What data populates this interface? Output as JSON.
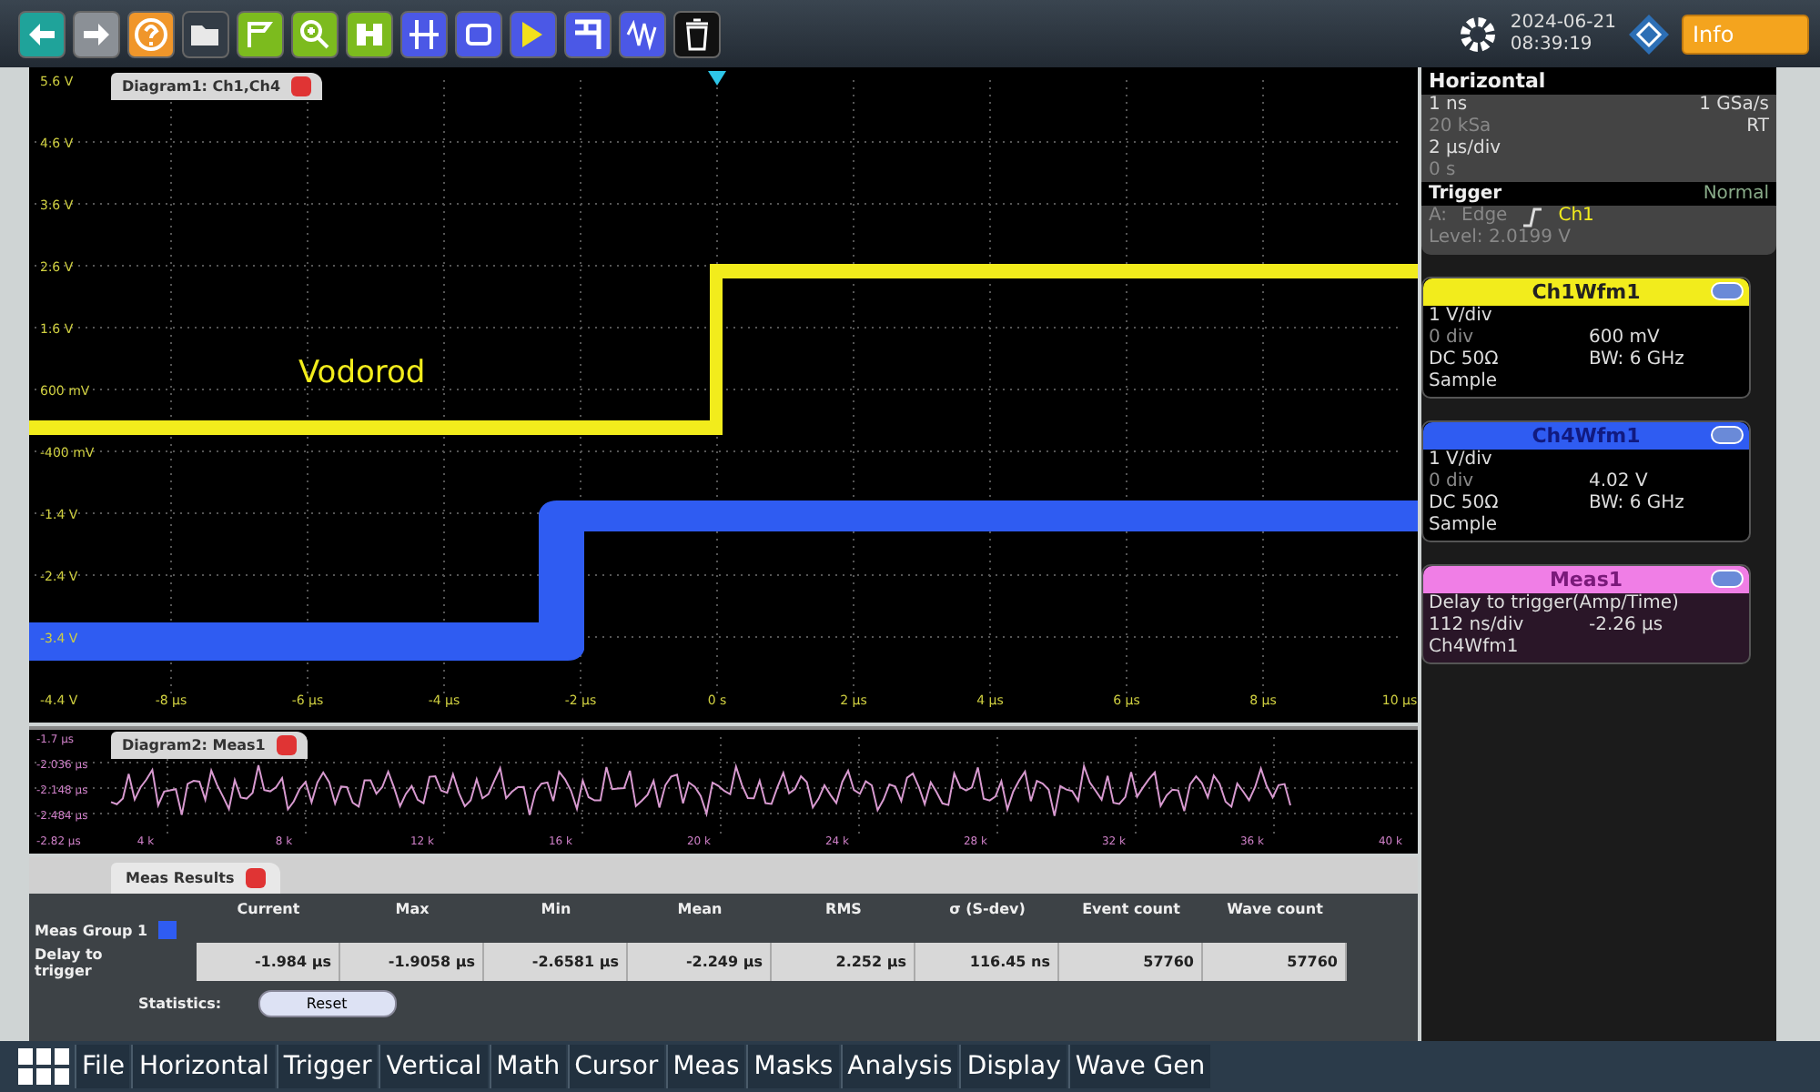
{
  "toolbar": {
    "tools": [
      {
        "kind": "back"
      },
      {
        "kind": "forward"
      },
      {
        "kind": "help"
      },
      {
        "kind": "open"
      },
      {
        "kind": "save"
      },
      {
        "kind": "zoom"
      },
      {
        "kind": "find"
      },
      {
        "kind": "cursor"
      },
      {
        "kind": "rect"
      },
      {
        "kind": "flag"
      },
      {
        "kind": "marker"
      },
      {
        "kind": "wave"
      },
      {
        "kind": "delete"
      }
    ],
    "date": "2024-06-21",
    "time": "08:39:19",
    "info": "Info"
  },
  "diagram1": {
    "title": "Diagram1: Ch1,Ch4",
    "annotation": "Vodorod",
    "y_labels": [
      "5.6 V",
      "4.6 V",
      "3.6 V",
      "2.6 V",
      "1.6 V",
      "600 mV",
      "-400 mV",
      "-1.4 V",
      "-2.4 V",
      "-3.4 V",
      "-4.4 V"
    ],
    "x_labels": [
      "-8 µs",
      "-6 µs",
      "-4 µs",
      "-2 µs",
      "0 s",
      "2 µs",
      "4 µs",
      "6 µs",
      "8 µs",
      "10 µs"
    ]
  },
  "diagram2": {
    "title": "Diagram2: Meas1",
    "y_labels": [
      "-1.7 µs",
      "-2.036 µs",
      "-2.148 µs",
      "-2.484 µs",
      "-2.82 µs"
    ],
    "x_labels": [
      "4 k",
      "8 k",
      "12 k",
      "16 k",
      "20 k",
      "24 k",
      "28 k",
      "32 k",
      "36 k",
      "40 k"
    ]
  },
  "horizontal": {
    "title": "Horizontal",
    "rows": [
      [
        "1 ns",
        "1 GSa/s"
      ],
      [
        "20 kSa",
        "RT"
      ],
      [
        "2 µs/div",
        ""
      ],
      [
        "0 s",
        ""
      ]
    ]
  },
  "trigger": {
    "title": "Trigger",
    "mode": "Normal",
    "source_prefix": "A:",
    "type": "Edge",
    "source": "Ch1",
    "level": "Level: 2.0199 V"
  },
  "channels": [
    {
      "title": "Ch1Wfm1",
      "color": "#f2ec1c",
      "kind": "channel",
      "rows": [
        [
          "1 V/div",
          ""
        ],
        [
          "0 div",
          "600 mV"
        ],
        [
          "DC 50Ω",
          "BW: 6 GHz"
        ],
        [
          "Sample",
          ""
        ]
      ]
    },
    {
      "title": "Ch4Wfm1",
      "color": "#2f5cf2",
      "kind": "channel",
      "rows": [
        [
          "1 V/div",
          ""
        ],
        [
          "0 div",
          "4.02 V"
        ],
        [
          "DC 50Ω",
          "BW: 6 GHz"
        ],
        [
          "Sample",
          ""
        ]
      ]
    },
    {
      "title": "Meas1",
      "color": "#f07ee6",
      "kind": "measurement",
      "rows": [
        [
          "Delay to trigger(Amp/Time)",
          ""
        ],
        [
          "112 ns/div",
          "-2.26 µs"
        ],
        [
          "Ch4Wfm1",
          ""
        ]
      ]
    }
  ],
  "meas_results": {
    "tab": "Meas Results",
    "columns": [
      "Current",
      "Max",
      "Min",
      "Mean",
      "RMS",
      "σ (S-dev)",
      "Event count",
      "Wave count"
    ],
    "group": "Meas Group 1",
    "group_checked": true,
    "row_label": "Delay to trigger",
    "values": [
      "-1.984 µs",
      "-1.9058 µs",
      "-2.6581 µs",
      "-2.249 µs",
      "2.252 µs",
      "116.45 ns",
      "57760",
      "57760"
    ],
    "statistics_label": "Statistics:",
    "reset": "Reset"
  },
  "menu": [
    "File",
    "Horizontal",
    "Trigger",
    "Vertical",
    "Math",
    "Cursor",
    "Meas",
    "Masks",
    "Analysis",
    "Display",
    "Wave Gen"
  ]
}
